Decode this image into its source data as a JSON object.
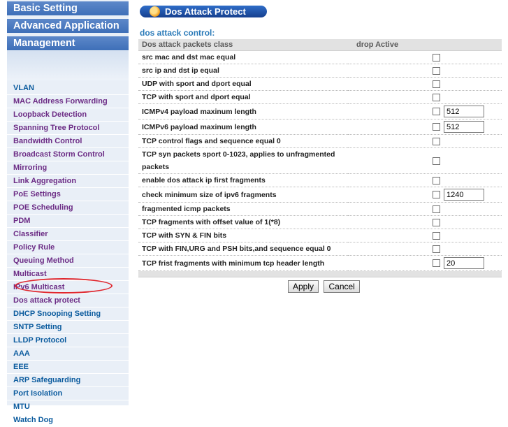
{
  "sidebar": {
    "top_menu": {
      "basic": "Basic Setting",
      "advanced": "Advanced Application",
      "management": "Management"
    },
    "items": [
      {
        "label": "VLAN",
        "color": "blue"
      },
      {
        "label": "MAC Address Forwarding",
        "color": "purple"
      },
      {
        "label": "Loopback Detection",
        "color": "purple"
      },
      {
        "label": "Spanning Tree Protocol",
        "color": "purple"
      },
      {
        "label": "Bandwidth Control",
        "color": "purple"
      },
      {
        "label": "Broadcast Storm Control",
        "color": "purple"
      },
      {
        "label": "Mirroring",
        "color": "purple"
      },
      {
        "label": "Link Aggregation",
        "color": "purple"
      },
      {
        "label": "PoE Settings",
        "color": "purple"
      },
      {
        "label": "POE Scheduling",
        "color": "purple"
      },
      {
        "label": "PDM",
        "color": "purple"
      },
      {
        "label": "Classifier",
        "color": "purple"
      },
      {
        "label": "Policy Rule",
        "color": "purple"
      },
      {
        "label": "Queuing Method",
        "color": "purple"
      },
      {
        "label": "Multicast",
        "color": "purple"
      },
      {
        "label": "IPv6 Multicast",
        "color": "purple"
      },
      {
        "label": "Dos attack protect",
        "color": "purple"
      },
      {
        "label": "DHCP Snooping Setting",
        "color": "blue"
      },
      {
        "label": "SNTP Setting",
        "color": "blue"
      },
      {
        "label": "LLDP Protocol",
        "color": "blue"
      },
      {
        "label": "AAA",
        "color": "blue"
      },
      {
        "label": "EEE",
        "color": "blue"
      },
      {
        "label": "ARP Safeguarding",
        "color": "blue"
      },
      {
        "label": "Port Isolation",
        "color": "blue"
      },
      {
        "label": "MTU",
        "color": "blue"
      },
      {
        "label": "Watch Dog",
        "color": "blue"
      }
    ],
    "active_item": "Dos attack protect"
  },
  "main": {
    "title": "Dos Attack Protect",
    "section_heading": "dos attack control:",
    "table": {
      "headers": [
        "Dos attack packets class",
        "drop Active"
      ],
      "rows": [
        {
          "label": "src mac and dst mac equal",
          "checked": false
        },
        {
          "label": "src ip and dst ip equal",
          "checked": false
        },
        {
          "label": "UDP with sport and dport equal",
          "checked": false
        },
        {
          "label": "TCP with sport and dport equal",
          "checked": false
        },
        {
          "label": "ICMPv4 payload maxinum length",
          "checked": false,
          "value": "512"
        },
        {
          "label": "ICMPv6 payload maxinum length",
          "checked": false,
          "value": "512"
        },
        {
          "label": "TCP control flags and sequence equal 0",
          "checked": false
        },
        {
          "label": "TCP syn packets sport 0-1023, applies to unfragmented packets",
          "checked": false
        },
        {
          "label": "enable dos attack ip first fragments",
          "checked": false
        },
        {
          "label": "check minimum size of ipv6 fragments",
          "checked": false,
          "value": "1240"
        },
        {
          "label": "fragmented icmp packets",
          "checked": false
        },
        {
          "label": "TCP fragments with offset value of 1(*8)",
          "checked": false
        },
        {
          "label": "TCP with SYN & FIN bits",
          "checked": false
        },
        {
          "label": "TCP with FIN,URG and PSH bits,and sequence equal 0",
          "checked": false
        },
        {
          "label": "TCP frist fragments with minimum tcp header length",
          "checked": false,
          "value": "20"
        }
      ]
    },
    "buttons": {
      "apply": "Apply",
      "cancel": "Cancel"
    }
  },
  "colors": {
    "nav_blue": "#0b5b9e",
    "nav_purple": "#6c2c85",
    "highlight_red": "#e0262d",
    "title_pill": "#1f55ad"
  }
}
